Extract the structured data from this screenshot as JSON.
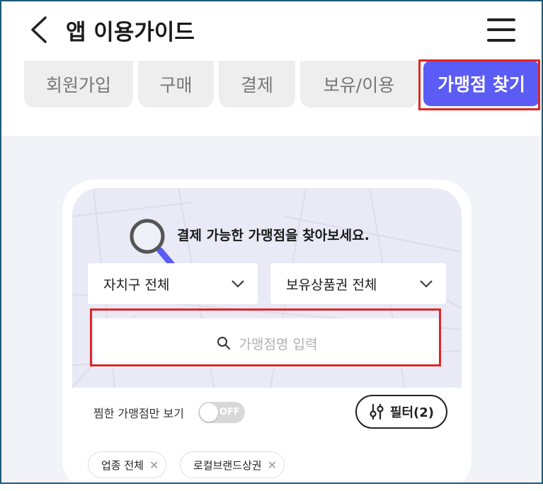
{
  "header": {
    "title": "앱 이용가이드"
  },
  "tabs": [
    {
      "label": "회원가입"
    },
    {
      "label": "구매"
    },
    {
      "label": "결제"
    },
    {
      "label": "보유/이용"
    },
    {
      "label": "가맹점 찾기",
      "active": true
    }
  ],
  "guide": {
    "headline": "결제 가능한 가맹점을 찾아보세요.",
    "district_select": "자치구 전체",
    "voucher_select": "보유상품권 전체",
    "search_placeholder": "가맹점명 입력",
    "wish_only_label": "찜한 가맹점만 보기",
    "toggle_text": "OFF",
    "filter_button": "필터(2)",
    "chips": [
      {
        "label": "업종 전체"
      },
      {
        "label": "로컬브랜드상권"
      }
    ]
  },
  "colors": {
    "accent": "#5b5cf6",
    "highlight": "#e02424",
    "background": "#f2f3f8"
  }
}
